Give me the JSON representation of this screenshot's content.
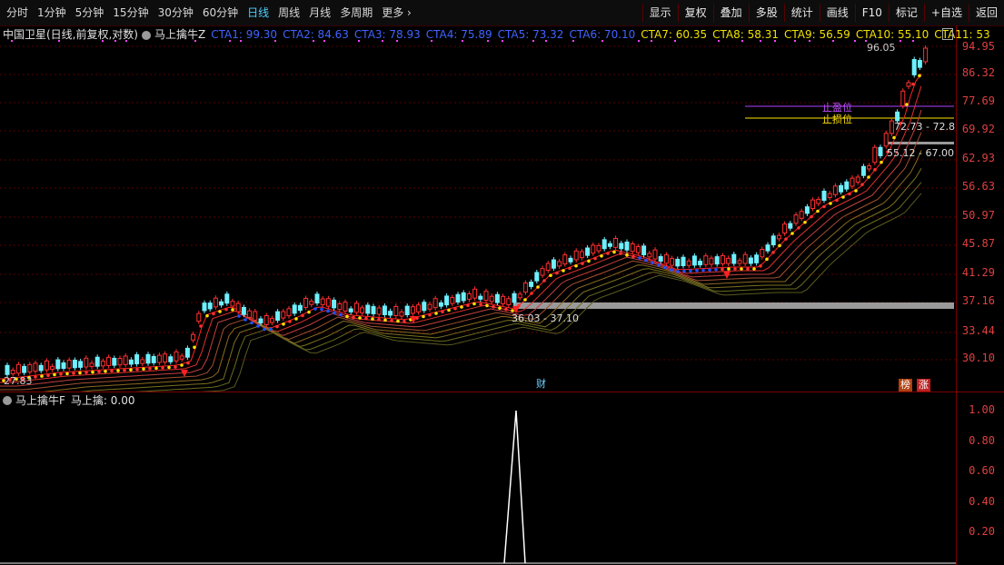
{
  "toolbar": {
    "periods": [
      "分时",
      "1分钟",
      "5分钟",
      "15分钟",
      "30分钟",
      "60分钟",
      "日线",
      "周线",
      "月线",
      "多周期",
      "更多"
    ],
    "active_period": "日线",
    "more_arrow": "›",
    "buttons": [
      "显示",
      "复权",
      "叠加",
      "多股",
      "统计",
      "画线",
      "F10",
      "标记",
      "+自选",
      "返回"
    ]
  },
  "info": {
    "stock": "中国卫星(日线,前复权,对数)",
    "indicator": "马上擒牛Z",
    "cta_blue": [
      "CTA1: 99.30",
      "CTA2: 84.63",
      "CTA3: 78.93",
      "CTA4: 75.89",
      "CTA5: 73.32",
      "CTA6: 70.10"
    ],
    "cta_yellow": [
      "CTA7: 60.35",
      "CTA8: 58.31",
      "CTA9: 56.59",
      "CTA10: 55.10",
      "CTA11: 53"
    ]
  },
  "price_axis": [
    "94.95",
    "86.32",
    "77.69",
    "69.92",
    "62.93",
    "56.63",
    "50.97",
    "45.87",
    "41.29",
    "37.16",
    "33.44",
    "30.10"
  ],
  "annotations": {
    "high": "96.05",
    "low": "27.83",
    "stop_profit": "止盈位",
    "stop_loss": "止损位",
    "range1": "72.73 - 72.8",
    "range2": "55.12 - 67.00",
    "range3": "36.03 - 37.10",
    "cai": "财",
    "bang": "榜",
    "zhang": "涨"
  },
  "sub": {
    "name": "马上擒牛F",
    "value_label": "马上擒: 0.00",
    "axis": [
      "1.00",
      "0.80",
      "0.60",
      "0.40",
      "0.20"
    ]
  },
  "colors": {
    "red": "#ff3030",
    "cyan": "#6ff0ff",
    "blue": "#2050ff",
    "yellow": "#ffe000",
    "purple": "#b040ff"
  }
}
